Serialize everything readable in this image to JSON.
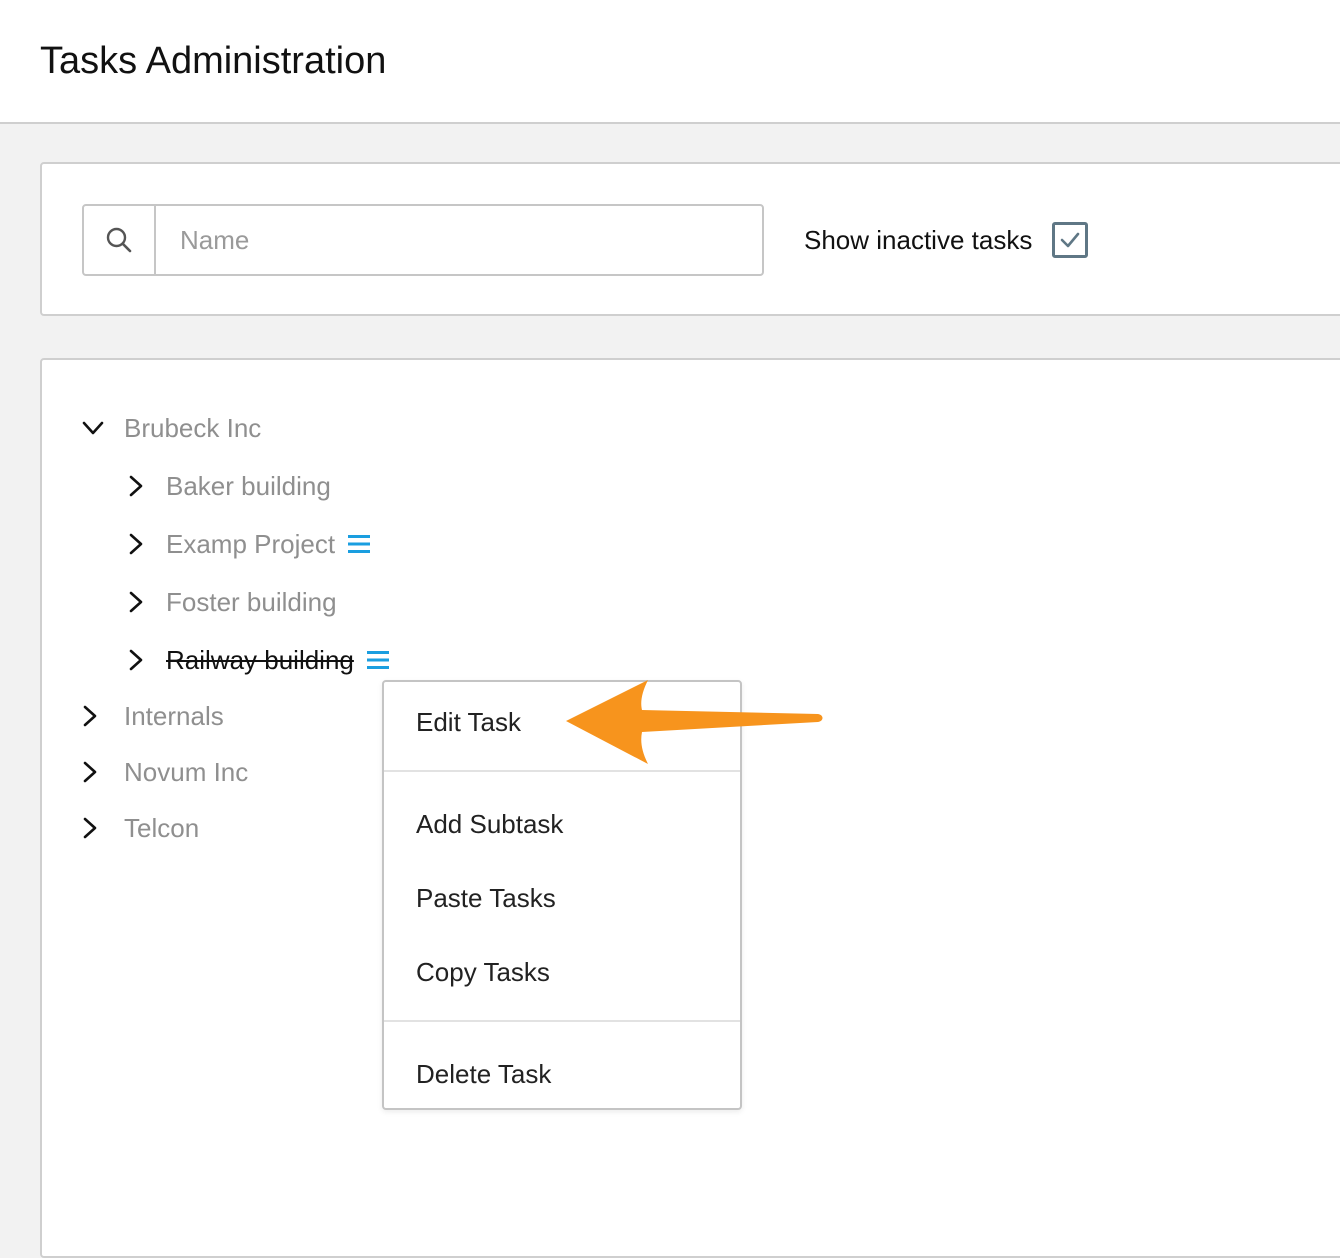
{
  "header": {
    "title": "Tasks Administration"
  },
  "filters": {
    "search": {
      "placeholder": "Name",
      "value": "",
      "icon": "search-icon"
    },
    "show_inactive": {
      "label": "Show inactive tasks",
      "checked": true,
      "color": "#5f7785"
    }
  },
  "tree": {
    "nodes": [
      {
        "label": "Brubeck Inc",
        "expanded": true,
        "level": 0,
        "has_menu": false,
        "inactive": false
      },
      {
        "label": "Baker building",
        "expanded": false,
        "level": 1,
        "has_menu": false,
        "inactive": false
      },
      {
        "label": "Examp Project",
        "expanded": false,
        "level": 1,
        "has_menu": true,
        "inactive": false
      },
      {
        "label": "Foster building",
        "expanded": false,
        "level": 1,
        "has_menu": false,
        "inactive": false
      },
      {
        "label": "Railway building",
        "expanded": false,
        "level": 1,
        "has_menu": true,
        "inactive": true
      },
      {
        "label": "Internals",
        "expanded": false,
        "level": 0,
        "has_menu": false,
        "inactive": false
      },
      {
        "label": "Novum Inc",
        "expanded": false,
        "level": 0,
        "has_menu": false,
        "inactive": false
      },
      {
        "label": "Telcon",
        "expanded": false,
        "level": 0,
        "has_menu": false,
        "inactive": false
      }
    ],
    "menu_icon_color": "#1a9ee0"
  },
  "context_menu": {
    "items": [
      {
        "label": "Edit Task"
      },
      {
        "label": "Add Subtask"
      },
      {
        "label": "Paste Tasks"
      },
      {
        "label": "Copy Tasks"
      },
      {
        "label": "Delete Task"
      }
    ]
  },
  "annotation": {
    "arrow_color": "#f7941d"
  }
}
